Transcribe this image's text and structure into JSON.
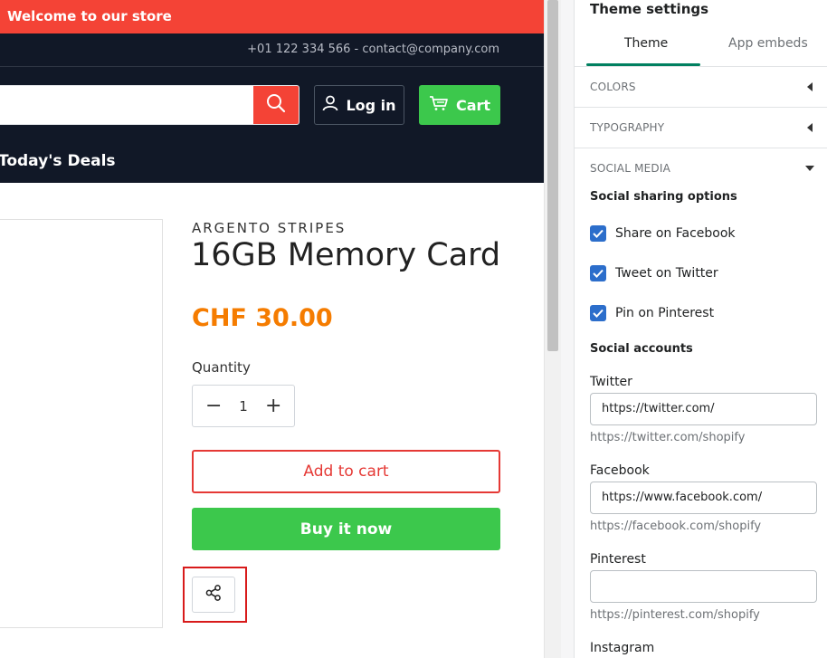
{
  "store": {
    "announcement": "Welcome to our store",
    "contact": "+01 122 334 566 - contact@company.com",
    "login_label": "Log in",
    "cart_label": "Cart",
    "nav_item": "Today's Deals",
    "product": {
      "vendor": "ARGENTO STRIPES",
      "title": "16GB Memory Card",
      "price": "CHF 30.00",
      "quantity_label": "Quantity",
      "quantity_value": "1",
      "add_to_cart": "Add to cart",
      "buy_now": "Buy it now"
    }
  },
  "panel": {
    "title": "Theme settings",
    "tabs": [
      {
        "label": "Theme",
        "active": true
      },
      {
        "label": "App embeds",
        "active": false
      }
    ],
    "sections": {
      "colors": "COLORS",
      "typography": "TYPOGRAPHY",
      "social_media": "SOCIAL MEDIA"
    },
    "sharing_heading": "Social sharing options",
    "sharing_options": [
      {
        "label": "Share on Facebook",
        "checked": true
      },
      {
        "label": "Tweet on Twitter",
        "checked": true
      },
      {
        "label": "Pin on Pinterest",
        "checked": true
      }
    ],
    "accounts_heading": "Social accounts",
    "accounts": [
      {
        "label": "Twitter",
        "value": "https://twitter.com/",
        "help": "https://twitter.com/shopify"
      },
      {
        "label": "Facebook",
        "value": "https://www.facebook.com/",
        "help": "https://facebook.com/shopify"
      },
      {
        "label": "Pinterest",
        "value": "",
        "help": "https://pinterest.com/shopify"
      },
      {
        "label": "Instagram"
      }
    ]
  },
  "colors": {
    "announcement_bg": "#f44336",
    "header_bg": "#111827",
    "cart_green": "#3cc84c",
    "price_orange": "#f57c00",
    "highlight_red": "#d81b1b",
    "checkbox_blue": "#2c6ecb",
    "tab_green": "#008060"
  }
}
